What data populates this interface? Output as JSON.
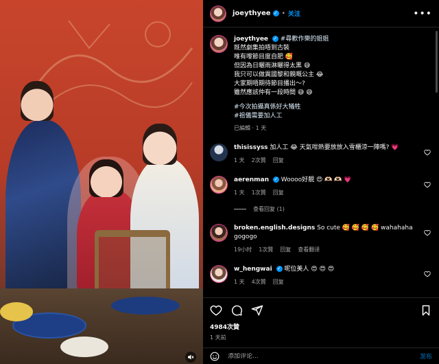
{
  "photo": {
    "alt_icon": "sound-off-icon"
  },
  "header": {
    "username": "joeythyee",
    "follow_label": "关注",
    "more_icon": "more-icon"
  },
  "caption": {
    "username": "joeythyee",
    "hashtag": "#尋歡作樂的姐姐",
    "lines": [
      "既然劇集拍唔到古裝",
      "唯有嚟節目度自肥 🥰",
      "但因為日曬雨淋曬得太黑 😅",
      "我只可以做異國黎和親嘅公主 😂",
      "大家期唔期待節目播出～?",
      "雖然應該仲有一段時間 😅 😅"
    ],
    "hashtags": [
      "#今次拍攝真係好大犧牲",
      "#祖儀需要加人工"
    ],
    "meta": "已編輯 · 1 天"
  },
  "comments": [
    {
      "username": "thisissyss",
      "verified": false,
      "text": "加人工 😂 天氣咁熱要放放入雪櫃涼一陣嗎? 💗",
      "time": "1 天",
      "likes": "2次贊",
      "reply": "回复"
    },
    {
      "username": "aerenman",
      "verified": true,
      "text": "Woooo好靚 😍 🫶🏻 🫶🏻 💗",
      "time": "1 天",
      "likes": "1次贊",
      "reply": "回复",
      "view_replies": "查看回复 (1)"
    },
    {
      "username": "broken.english.designs",
      "verified": false,
      "text": "So cute 🥰 🥰 🥰 🥰 wahahaha gogogo",
      "time": "19小时",
      "likes": "1次贊",
      "reply": "回复",
      "translate": "查看翻译"
    },
    {
      "username": "w_hengwai",
      "verified": true,
      "text": "呢位美人 😍 😍 😍",
      "time": "1 天",
      "likes": "4次贊",
      "reply": "回复"
    }
  ],
  "actions": {
    "likes": "4984次贊",
    "date": "1 天前"
  },
  "add_comment": {
    "placeholder": "添加评论...",
    "post_label": "发布"
  },
  "colors": {
    "accent": "#0095f6",
    "background": "#000000",
    "secondary_text": "#a8a8a8",
    "like_red": "#ff3040"
  }
}
